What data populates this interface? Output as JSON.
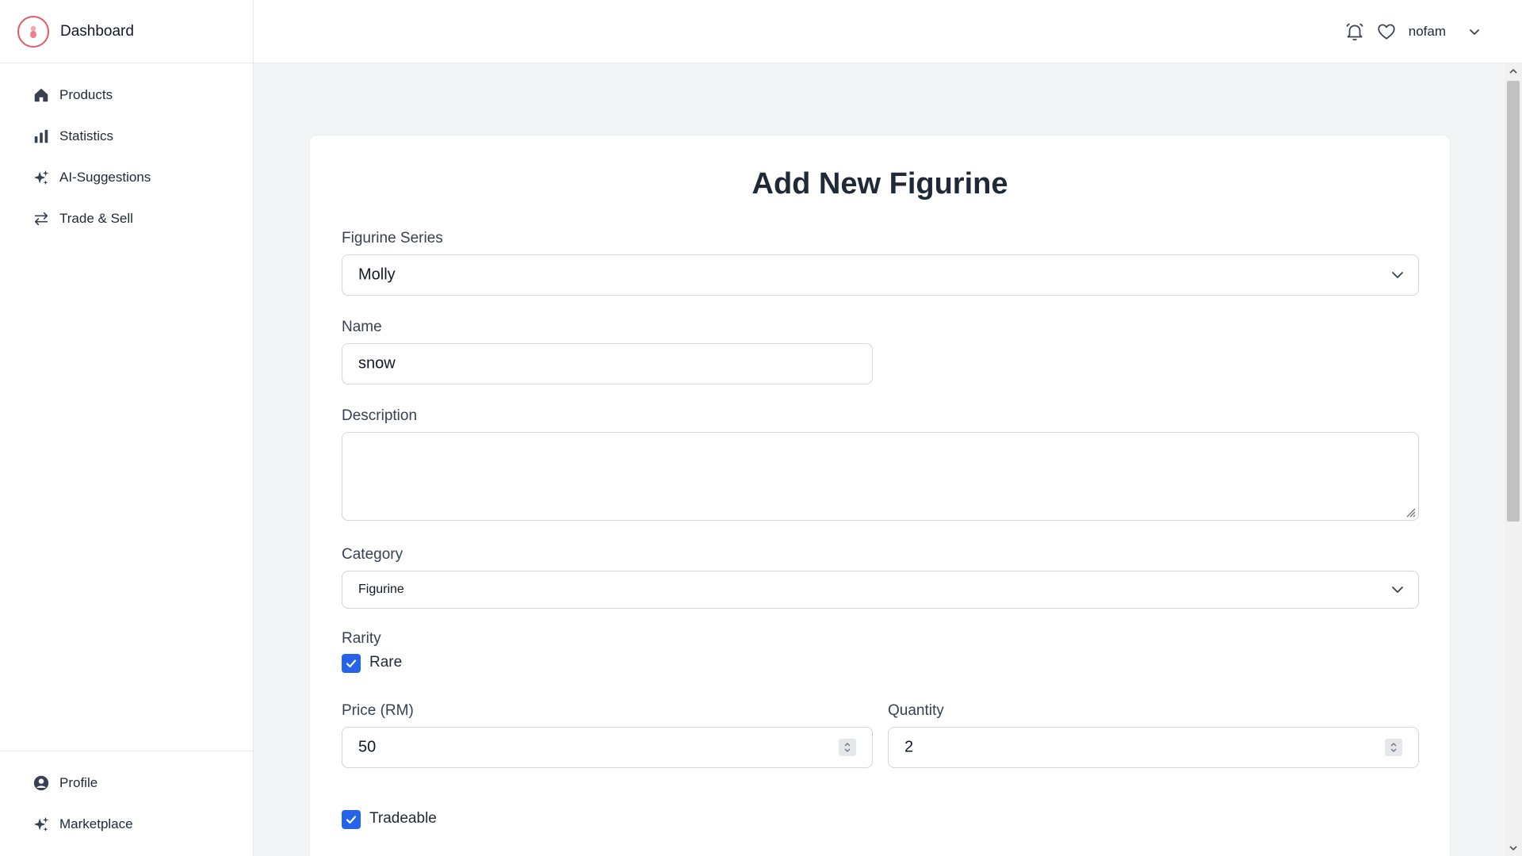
{
  "brand": {
    "title": "Dashboard"
  },
  "sidebar": {
    "items": [
      {
        "label": "Products",
        "icon": "home-icon"
      },
      {
        "label": "Statistics",
        "icon": "bar-chart-icon"
      },
      {
        "label": "AI-Suggestions",
        "icon": "sparkles-icon"
      },
      {
        "label": "Trade & Sell",
        "icon": "swap-arrows-icon"
      }
    ],
    "bottom_items": [
      {
        "label": "Profile",
        "icon": "user-circle-icon"
      },
      {
        "label": "Marketplace",
        "icon": "sparkles-icon"
      }
    ]
  },
  "topbar": {
    "username": "nofam"
  },
  "form": {
    "title": "Add New Figurine",
    "series_label": "Figurine Series",
    "series_value": "Molly",
    "name_label": "Name",
    "name_value": "snow",
    "description_label": "Description",
    "description_value": "",
    "category_label": "Category",
    "category_value": "Figurine",
    "rarity_label": "Rarity",
    "rarity_option": "Rare",
    "rarity_checked": true,
    "price_label": "Price (RM)",
    "price_value": "50",
    "quantity_label": "Quantity",
    "quantity_value": "2",
    "tradeable_label": "Tradeable",
    "tradeable_checked": true
  },
  "colors": {
    "accent": "#2563eb",
    "brand": "#e05a6a",
    "background": "#f3f4f6"
  }
}
